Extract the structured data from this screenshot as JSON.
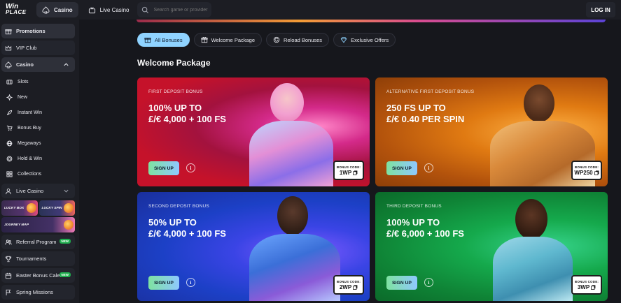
{
  "header": {
    "logo_line1": "Win",
    "logo_line2": "PLACE",
    "nav": [
      {
        "label": "Casino",
        "icon": "spade-icon",
        "active": true
      },
      {
        "label": "Live Casino",
        "icon": "live-tv-icon",
        "active": false
      }
    ],
    "search_placeholder": "Search game or provider",
    "login_label": "LOG IN"
  },
  "sidebar": {
    "top_items": [
      {
        "label": "Promotions",
        "icon": "gift-icon"
      },
      {
        "label": "VIP Club",
        "icon": "crown-icon"
      },
      {
        "label": "Casino",
        "icon": "spade-icon"
      }
    ],
    "casino_sub": [
      {
        "label": "Slots",
        "icon": "slot-machine-icon"
      },
      {
        "label": "New",
        "icon": "sparkle-icon"
      },
      {
        "label": "Instant Win",
        "icon": "rocket-icon"
      },
      {
        "label": "Bonus Buy",
        "icon": "cart-icon"
      },
      {
        "label": "Megaways",
        "icon": "globe-icon"
      },
      {
        "label": "Hold & Win",
        "icon": "coin-icon"
      },
      {
        "label": "Collections",
        "icon": "grid-icon"
      }
    ],
    "live_casino": "Live Casino",
    "tiles": {
      "lucky_box": "LUCKY BOX",
      "lucky_spin": "LUCKY SPIN",
      "journey_map": "JOURNEY MAP"
    },
    "bottom_items": [
      {
        "label": "Referral Program",
        "icon": "users-icon",
        "badge": "NEW"
      },
      {
        "label": "Tournaments",
        "icon": "trophy-icon",
        "badge": ""
      },
      {
        "label": "Easter Bonus Cale...",
        "icon": "calendar-icon",
        "badge": "NEW"
      },
      {
        "label": "Spring Missions",
        "icon": "flag-icon",
        "badge": ""
      }
    ]
  },
  "main": {
    "tabs": [
      {
        "label": "All Bonuses",
        "icon": "gift-icon",
        "active": true
      },
      {
        "label": "Welcome Package",
        "icon": "gift-box-icon",
        "active": false
      },
      {
        "label": "Reload Bonuses",
        "icon": "reload-icon",
        "active": false
      },
      {
        "label": "Exclusive Offers",
        "icon": "diamond-icon",
        "active": false
      }
    ],
    "section_title": "Welcome Package",
    "cards": [
      {
        "label": "FIRST DEPOSIT BONUS",
        "title_line1": "100% UP TO",
        "title_line2": "£/€ 4,000 + 100 FS",
        "signup": "SIGN UP",
        "code_label": "BONUS CODE:",
        "code": "1WP"
      },
      {
        "label": "ALTERNATIVE FIRST DEPOSIT BONUS",
        "title_line1": "250 FS UP TO",
        "title_line2": "£/€ 0.40 PER SPIN",
        "signup": "SIGN UP",
        "code_label": "BONUS CODE:",
        "code": "WP250"
      },
      {
        "label": "SECOND DEPOSIT BONUS",
        "title_line1": "50% UP TO",
        "title_line2": "£/€ 4,000 + 100 FS",
        "signup": "SIGN UP",
        "code_label": "BONUS CODE:",
        "code": "2WP"
      },
      {
        "label": "THIRD DEPOSIT BONUS",
        "title_line1": "100% UP TO",
        "title_line2": "£/€ 6,000 + 100 FS",
        "signup": "SIGN UP",
        "code_label": "BONUS CODE:",
        "code": "3WP"
      }
    ]
  }
}
